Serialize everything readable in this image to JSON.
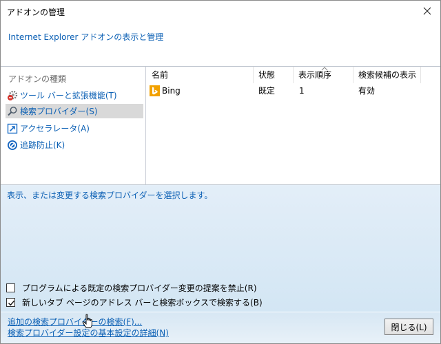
{
  "window": {
    "title": "アドオンの管理",
    "subtitle": "Internet Explorer アドオンの表示と管理"
  },
  "sidebar": {
    "section_label": "アドオンの種類",
    "items": [
      {
        "label": "ツール バーと拡張機能(T)",
        "icon": "gear-icon"
      },
      {
        "label": "検索プロバイダー(S)",
        "icon": "search-icon",
        "selected": true
      },
      {
        "label": "アクセラレータ(A)",
        "icon": "accelerator-icon"
      },
      {
        "label": "追跡防止(K)",
        "icon": "tracking-protection-icon"
      }
    ]
  },
  "table": {
    "columns": [
      "名前",
      "状態",
      "表示順序",
      "検索候補の表示"
    ],
    "rows": [
      {
        "name": "Bing",
        "status": "既定",
        "order": "1",
        "suggestions": "有効"
      }
    ]
  },
  "details": {
    "description": "表示、または変更する検索プロバイダーを選択します。",
    "checkbox1_label": "プログラムによる既定の検索プロバイダー変更の提案を禁止(R)",
    "checkbox1_checked": false,
    "checkbox2_label": "新しいタブ ページのアドレス バーと検索ボックスで検索する(B)",
    "checkbox2_checked": true
  },
  "footer": {
    "link1": "追加の検索プロバイダーの検索(F)...",
    "link2": "検索プロバイダー設定の基本設定の詳細(N)",
    "close_button": "閉じる(L)"
  },
  "colors": {
    "link": "#0a5fb4",
    "bing": "#f2a100"
  }
}
